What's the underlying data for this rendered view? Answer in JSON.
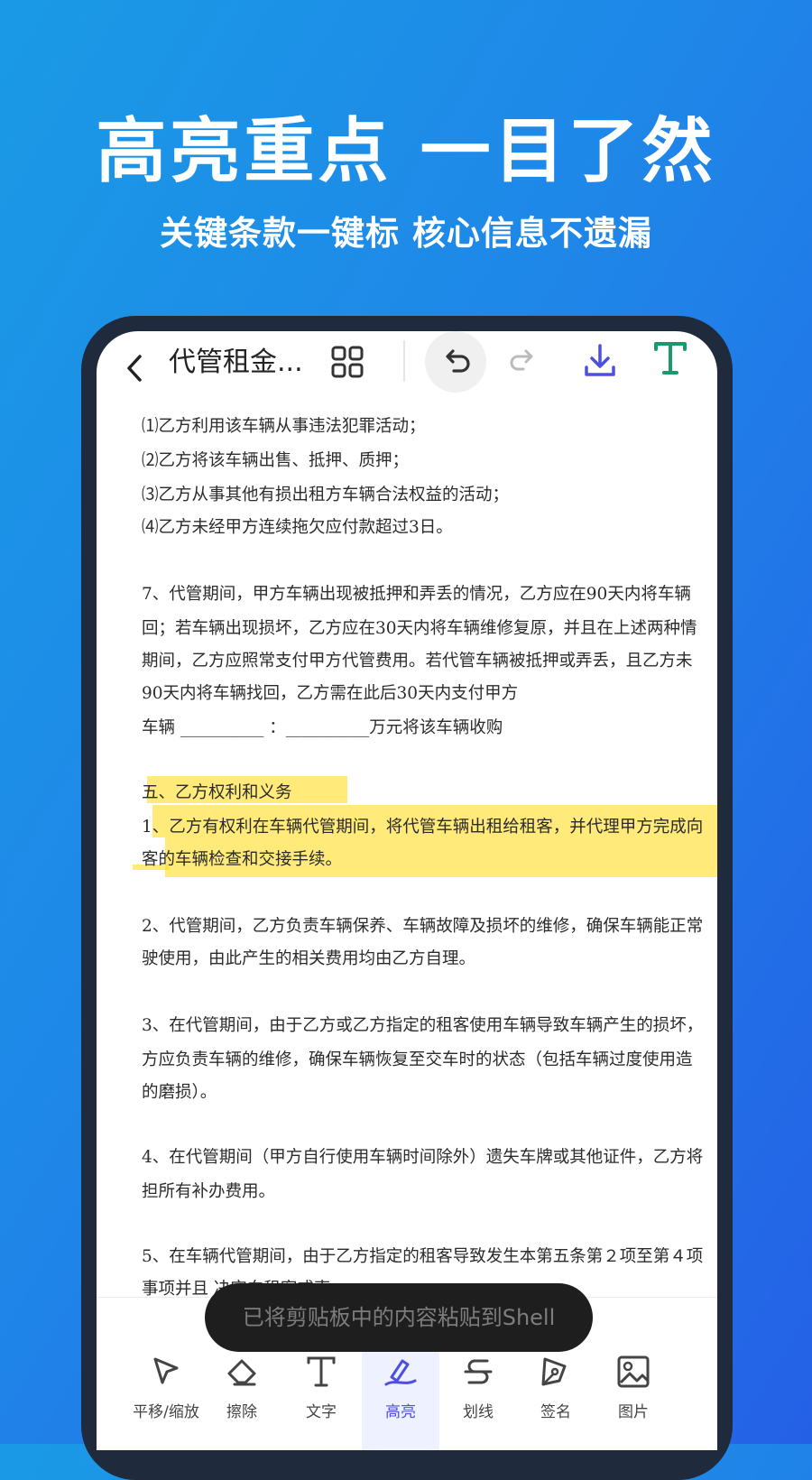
{
  "hero": {
    "title": "高亮重点 一目了然",
    "subtitle": "关键条款一键标 核心信息不遗漏"
  },
  "header": {
    "doc_title": "代管租金...",
    "icons": [
      "back-icon",
      "grid-icon",
      "undo-icon",
      "redo-icon",
      "download-icon",
      "text-tool-icon"
    ],
    "accent_download": "#4c4fe0",
    "accent_text": "#1a9a6a"
  },
  "document": {
    "lines": [
      "⑴乙方利用该车辆从事违法犯罪活动；",
      "⑵乙方将该车辆出售、抵押、质押；",
      "⑶乙方从事其他有损出租方车辆合法权益的活动；",
      "⑷乙方未经甲方连续拖欠应付款超过3日。",
      "7、代管期间，甲方车辆出现被抵押和弄丢的情况，乙方应在90天内将车辆",
      "回；若车辆出现损坏，乙方应在30天内将车辆维修复原，并且在上述两种情",
      "期间，乙方应照常支付甲方代管费用。若代管车辆被抵押或弄丢，且乙方未",
      "90天内将车辆找回，乙方需在此后30天内支付甲方",
      "车辆 __________    ：__________万元将该车辆收购",
      "五、乙方权利和义务",
      "1、乙方有权利在车辆代管期间，将代管车辆出租给租客，并代理甲方完成向",
      "客的车辆检查和交接手续。",
      "2、代管期间，乙方负责车辆保养、车辆故障及损坏的维修，确保车辆能正常",
      "驶使用，由此产生的相关费用均由乙方自理。",
      "3、在代管期间，由于乙方或乙方指定的租客使用车辆导致车辆产生的损坏，",
      "方应负责车辆的维修，确保车辆恢复至交车时的状态（包括车辆过度使用造",
      "的磨损）。",
      "4、在代管期间（甲方自行使用车辆时间除外）遗失车牌或其他证件，乙方将",
      "担所有补办费用。",
      "5、在车辆代管期间，由于乙方指定的租客导致发生本第五条第２项至第４项",
      "事项并且                                                决定向租客或索"
    ],
    "highlight_color": "#ffdd28"
  },
  "toast": {
    "text": "已将剪贴板中的内容粘贴到Shell"
  },
  "toolbar": {
    "tools": [
      {
        "label": "平移/缩放",
        "icon": "cursor-icon"
      },
      {
        "label": "擦除",
        "icon": "eraser-icon"
      },
      {
        "label": "文字",
        "icon": "text-icon"
      },
      {
        "label": "高亮",
        "icon": "highlighter-icon"
      },
      {
        "label": "划线",
        "icon": "strikethrough-icon"
      },
      {
        "label": "签名",
        "icon": "pen-nib-icon"
      },
      {
        "label": "图片",
        "icon": "image-icon"
      }
    ],
    "active_tool": "高亮",
    "active_color": "#4c4fe0"
  }
}
